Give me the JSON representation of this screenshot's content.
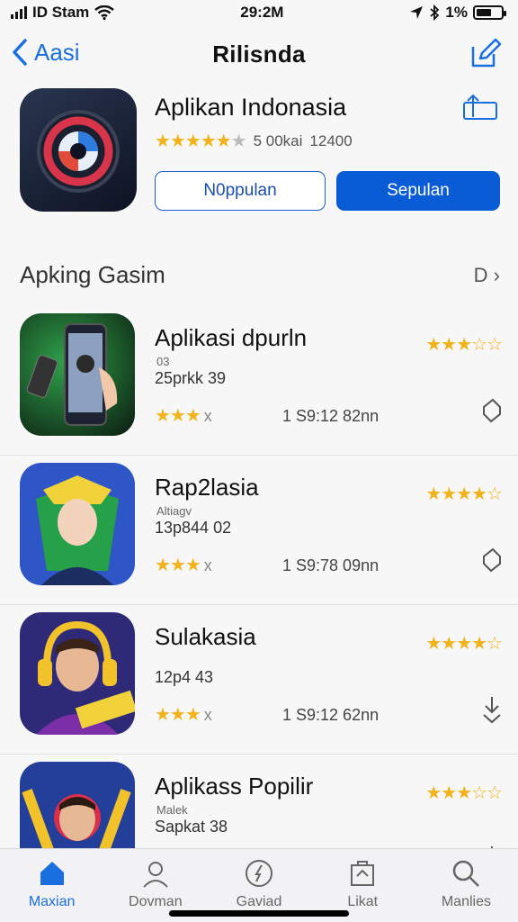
{
  "status": {
    "carrier": "ID Stam",
    "time": "29:2M",
    "battery": "1%"
  },
  "nav": {
    "back_label": "Aasi",
    "title": "Rilisnda"
  },
  "hero": {
    "title": "Aplikan Indonasia",
    "rating_text": "5 00kai",
    "count": "12400",
    "stars": 4.5,
    "btn_outline": "N0ppulan",
    "btn_fill": "Sepulan"
  },
  "section": {
    "title": "Apking Gasim",
    "see_all": "D ›"
  },
  "apps": [
    {
      "title": "Aplikasi dpurln",
      "sub": "03",
      "meta": "25prkk 39",
      "stars_text": "★★★",
      "size": "1 S9:12 82nn",
      "top_stars": "★★★☆☆"
    },
    {
      "title": "Rap2lasia",
      "sub": "Altiagv",
      "meta": "13p844 02",
      "stars_text": "★★★",
      "size": "1 S9:78 09nn",
      "top_stars": "★★★★☆"
    },
    {
      "title": "Sulakasia",
      "sub": "",
      "meta": "12p4 43",
      "stars_text": "★★★",
      "size": "1 S9:12 62nn",
      "top_stars": "★★★★☆"
    },
    {
      "title": "Aplikass Popilir",
      "sub": "Malek",
      "meta": "Sapkat 38",
      "stars_text": "★★★",
      "size": "",
      "top_stars": "★★★☆☆"
    }
  ],
  "tabs": [
    {
      "label": "Maxian",
      "icon": "home-icon"
    },
    {
      "label": "Dovman",
      "icon": "person-icon"
    },
    {
      "label": "Gaviad",
      "icon": "compass-icon"
    },
    {
      "label": "Likat",
      "icon": "bag-icon"
    },
    {
      "label": "Manlies",
      "icon": "search-icon"
    }
  ]
}
